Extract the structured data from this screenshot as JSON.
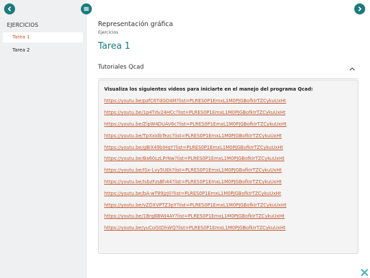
{
  "sidebar": {
    "heading": "EJERCICIOS",
    "items": [
      {
        "label": "Tarea 1",
        "active": true
      },
      {
        "label": "Tarea 2",
        "active": false
      }
    ]
  },
  "nav": {
    "left_icon": "chevron-left-icon",
    "menu_icon": "hamburger-menu-icon",
    "right_icon": "chevron-right-icon"
  },
  "main": {
    "title": "Representación gráfica",
    "subtitle": "Ejercicios",
    "task_title": "Tarea 1",
    "section": {
      "title": "Tutoriales Qcad",
      "toggle_icon": "chevron-up-icon",
      "intro": "Visualiza los siguientes videos para iniciarte en el manejo del programa Qcad:",
      "links": [
        "https://youtu.be/pzfC6TdGO4M?list=PLRES0P1EmxL1M0PJGBofkIrTZCykuUxHt",
        "https://youtu.be/1p4Tdv24HCc?list=PLRES0P1EmxL1M0PJGBofkIrTZCykuUxHt",
        "https://youtu.be/ZlpW4DUAV6c?list=PLRES0P1EmxL1M0PJGBofkIrTZCykuUxHt",
        "https://youtu.be/TpXxIdbTezc?list=PLRES0P1EmxL1M0PJGBofkIrTZCykuUxHt",
        "https://youtu.be/gBIX49bIHqY?list=PLRES0P1EmxL1M0PJGBofkIrTZCykuUxHt",
        "https://youtu.be/Ba60LzLPrNw?list=PLRES0P1EmxL1M0PJGBofkIrTZCykuUxHt",
        "https://youtu.be/ISx-Lvy5UEk?list=PLRES0P1EmxL1M0PJGBofkIrTZCykuUxHt",
        "https://youtu.be/IsbzFzsBh44?list=PLRES0P1EmxL1M0PJGBofkIrTZCykuUxHt",
        "https://youtu.be/bA-wT89jzj0?list=PLRES0P1EmxL1M0PJGBofkIrTZCykuUxHt",
        "https://youtu.be/vZDXVPTZ3pY?list=PLRES0P1EmxL1M0PJGBofkIrTZCykuUxHt",
        "https://youtu.be/1BrgBBWJ4AY?list=PLRES0P1EmxL1M0PJGBofkIrTZCykuUxHt",
        "https://youtu.be/yuCoiStDhWQ?list=PLRES0P1EmxL1M0PJGBofkIrTZCykuUxHt"
      ]
    }
  },
  "footer": {
    "corner_icon": "puzzle-icon"
  },
  "colors": {
    "accent": "#1a7a7c",
    "link": "#c1572e",
    "sidebar_bg": "#eff0f1"
  }
}
